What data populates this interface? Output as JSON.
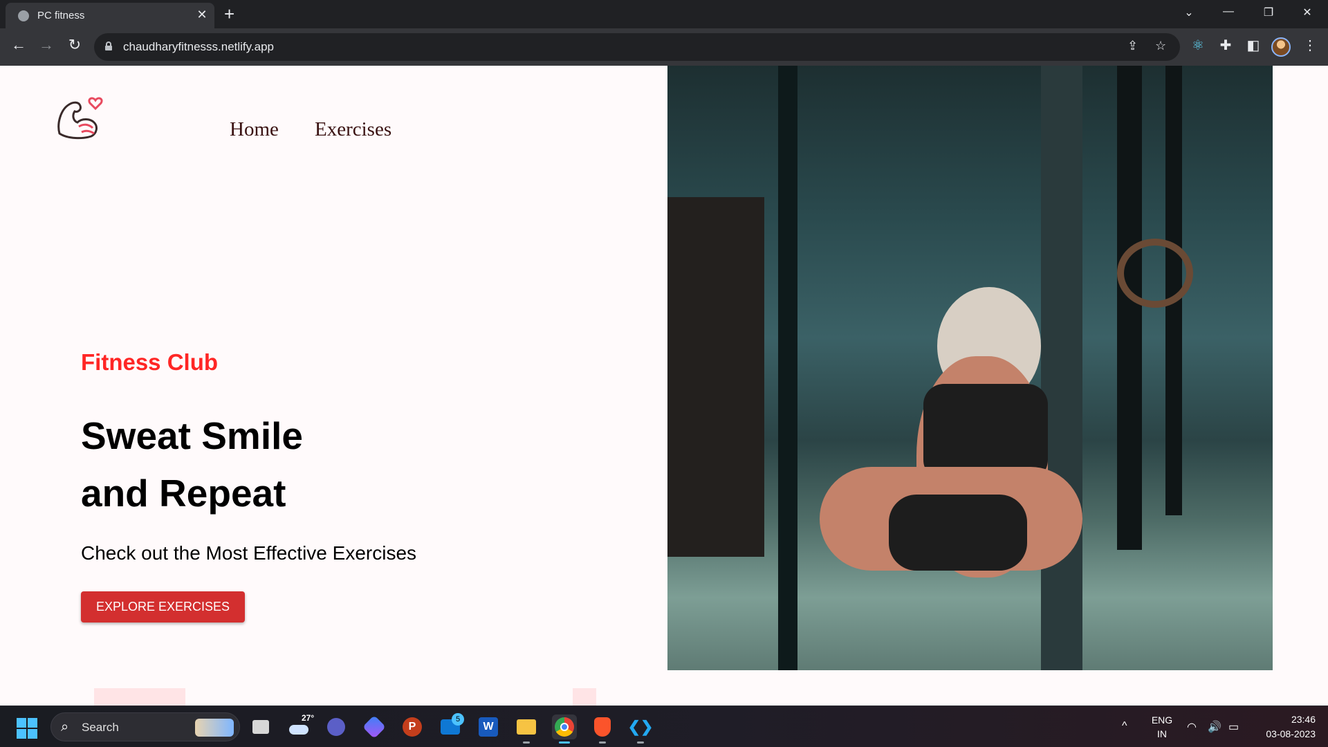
{
  "browser": {
    "tab_title": "PC fitness",
    "tab_close": "✕",
    "new_tab": "+",
    "url": "chaudharyfitnesss.netlify.app",
    "window_controls": {
      "list_tabs": "⌄",
      "minimize": "—",
      "restore": "❐",
      "close": "✕"
    },
    "nav": {
      "back": "←",
      "forward": "→",
      "reload": "↻"
    },
    "omnibox_icons": {
      "share": "⇪",
      "bookmark": "☆"
    },
    "toolbar_icons": {
      "react_devtools": "⚛",
      "extensions": "✚",
      "side_panel": "◧",
      "menu": "⋮"
    }
  },
  "site": {
    "nav_links": [
      "Home",
      "Exercises"
    ],
    "subtitle": "Fitness Club",
    "headline_line1": "Sweat Smile",
    "headline_line2": "and Repeat",
    "tagline": "Check out the Most Effective Exercises",
    "cta_label": "EXPLORE EXERCISES",
    "accent_color": "#ff2625",
    "button_color": "#d32f2f"
  },
  "taskbar": {
    "search_label": "Search",
    "search_icon": "⌕",
    "weather_temp": "27°",
    "mail_badge": "5",
    "apps": [
      "File Explorer",
      "Weather",
      "Teams",
      "Copilot",
      "PowerPoint",
      "Mail",
      "Word",
      "Files",
      "Chrome",
      "Brave",
      "VS Code"
    ],
    "app_glyphs": {
      "powerpoint": "P",
      "word": "W",
      "vscode": "❮❯"
    },
    "language": "ENG",
    "region": "IN",
    "time": "23:46",
    "date": "03-08-2023",
    "tray_chevron": "^",
    "tray_icons": {
      "wifi": "◠",
      "volume": "🔊",
      "battery": "▭"
    }
  }
}
